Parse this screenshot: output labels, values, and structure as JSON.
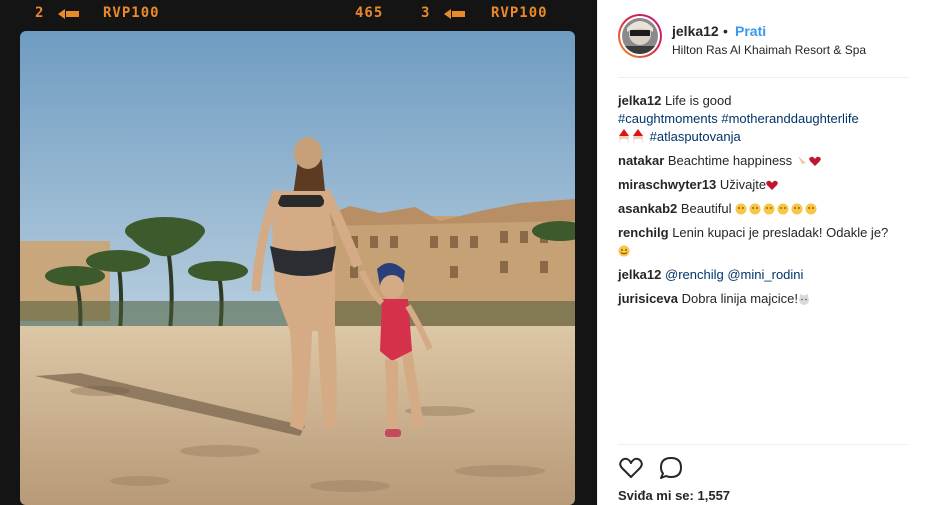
{
  "photo": {
    "film_left_frame": "2",
    "film_left_code": "RVP100",
    "film_counter": "465",
    "film_right_frame": "3",
    "film_right_code": "RVP100"
  },
  "header": {
    "username": "jelka12",
    "separator": "•",
    "follow_label": "Prati",
    "location": "Hilton Ras Al Khaimah Resort & Spa"
  },
  "caption": {
    "username": "jelka12",
    "text": "Life is good",
    "hashtag_1": "#caughtmoments",
    "hashtag_2": "#motheranddaughterlife",
    "hashtag_3": "#atlasputovanja"
  },
  "comments": [
    {
      "username": "natakar",
      "text": "Beachtime happiness"
    },
    {
      "username": "miraschwyter13",
      "text": "Uživajte"
    },
    {
      "username": "asankab2",
      "text": "Beautiful"
    },
    {
      "username": "renchilg",
      "text": "Lenin kupaci je presladak! Odakle je?"
    },
    {
      "username": "jelka12",
      "mention_1": "@renchilg",
      "mention_2": "@mini_rodini"
    },
    {
      "username": "jurisiceva",
      "text": "Dobra linija majcice!"
    }
  ],
  "likes": {
    "label": "Sviđa mi se:",
    "count": "1,557"
  },
  "icons": [
    "like-icon",
    "comment-icon",
    "film-arrow-icon"
  ],
  "colors": {
    "link": "#003569",
    "follow": "#3897f0",
    "film_text": "#e8892c",
    "heart": "#c0152f"
  }
}
